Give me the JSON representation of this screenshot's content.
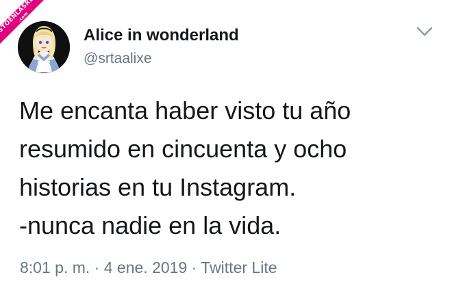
{
  "watermark": {
    "line1": "VISTOENLASREDES",
    "line2": ".com"
  },
  "user": {
    "display_name": "Alice in wonderland",
    "handle": "@srtaalixe",
    "avatar_icon": "alice-avatar"
  },
  "tweet": {
    "text": "Me encanta haber visto tu año\nresumido en cincuenta y ocho\nhistorias en tu Instagram.\n-nunca nadie en la vida.",
    "time": "8:01 p. m.",
    "separator": "·",
    "date": "4 ene. 2019",
    "source": "Twitter Lite"
  },
  "colors": {
    "text": "#14171a",
    "secondary": "#657786",
    "watermark": "#e4007c",
    "caret": "#8899a6"
  }
}
